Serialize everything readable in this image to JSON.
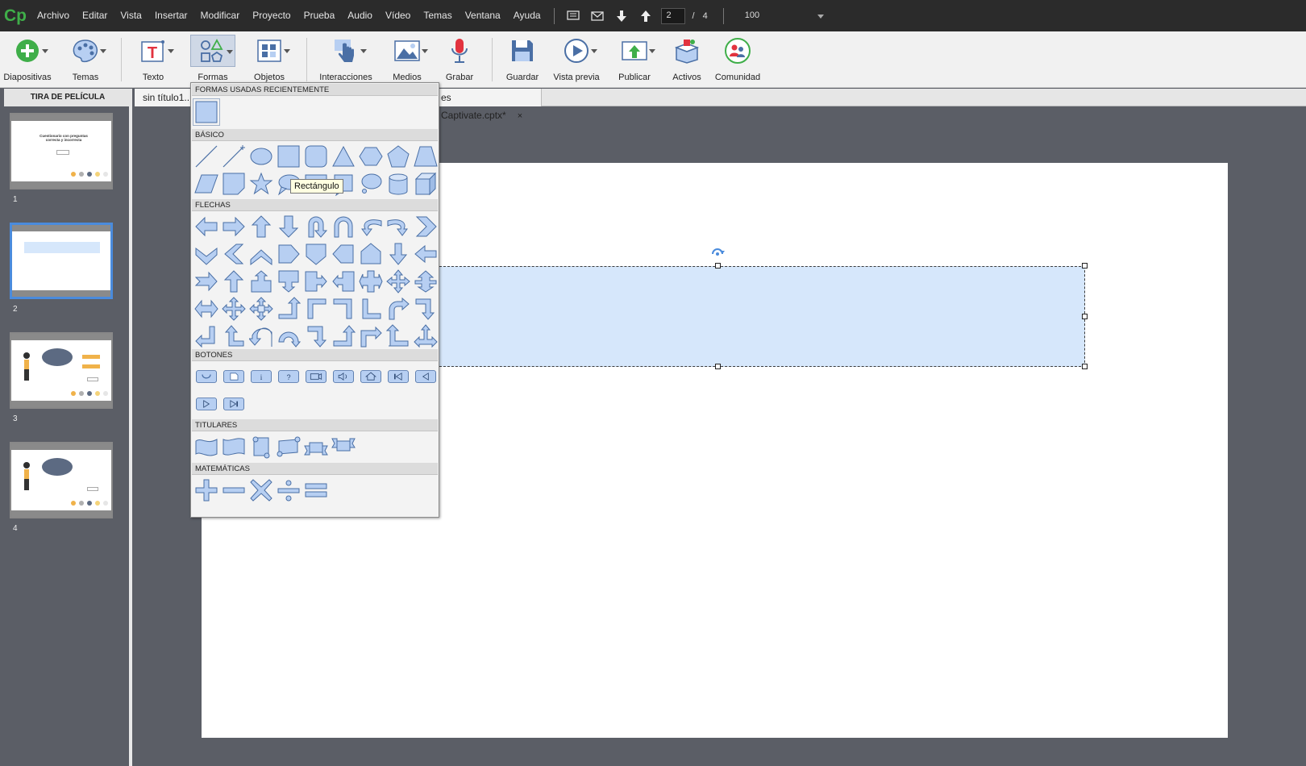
{
  "app": {
    "logo": "Cp"
  },
  "menu": [
    "Archivo",
    "Editar",
    "Vista",
    "Insertar",
    "Modificar",
    "Proyecto",
    "Prueba",
    "Audio",
    "Vídeo",
    "Temas",
    "Ventana",
    "Ayuda"
  ],
  "slide_nav": {
    "current": "2",
    "separator": "/",
    "total": "4"
  },
  "zoom": {
    "value": "100"
  },
  "toolbar": {
    "diapositivas": "Diapositivas",
    "temas": "Temas",
    "texto": "Texto",
    "formas": "Formas",
    "objetos": "Objetos",
    "interacciones": "Interacciones",
    "medios": "Medios",
    "grabar": "Grabar",
    "guardar": "Guardar",
    "vista_previa": "Vista previa",
    "publicar": "Publicar",
    "activos": "Activos",
    "comunidad": "Comunidad"
  },
  "filmstrip": {
    "header": "TIRA DE PELÍCULA",
    "slides": [
      "1",
      "2",
      "3",
      "4"
    ],
    "slide1_title": "Cuestionario con preguntas correcta y incorrecta"
  },
  "tabs": [
    {
      "label": "sin título1..."
    },
    {
      "label": "es Captivate.cptx*",
      "close": "×"
    }
  ],
  "shapes_panel": {
    "recent": "FORMAS USADAS RECIENTEMENTE",
    "basico": "BÁSICO",
    "flechas": "FLECHAS",
    "botones": "BOTONES",
    "titulares": "TITULARES",
    "matematicas": "MATEMÁTICAS"
  },
  "tooltip": "Rectángulo",
  "colors": {
    "menubar_bg": "#2b2b2b",
    "logo_green": "#3fae49",
    "shape_fill": "#d6e7fb",
    "icon_fill": "#b7cff2",
    "selection_blue": "#4a8bdc"
  }
}
